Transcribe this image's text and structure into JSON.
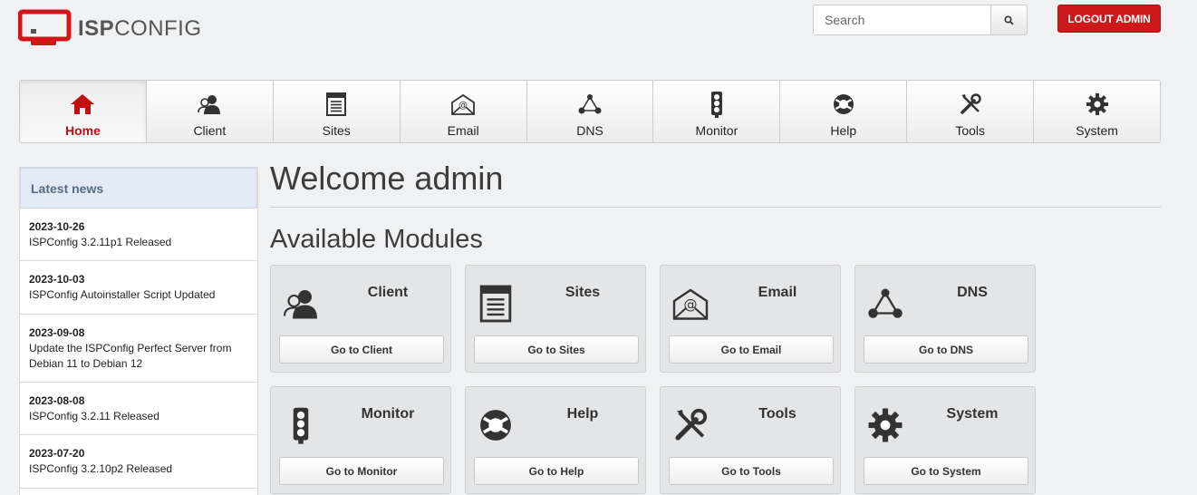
{
  "header": {
    "logo_bold": "ISP",
    "logo_light": "CONFIG",
    "search_placeholder": "Search",
    "logout_label": "LOGOUT ADMIN"
  },
  "colors": {
    "accent_red": "#cc1a1a",
    "active_nav_text": "#c20e0e",
    "sidebar_header_bg": "#e1eaf5"
  },
  "nav": [
    {
      "label": "Home",
      "icon": "home-icon",
      "active": true
    },
    {
      "label": "Client",
      "icon": "client-icon"
    },
    {
      "label": "Sites",
      "icon": "sites-icon"
    },
    {
      "label": "Email",
      "icon": "email-icon"
    },
    {
      "label": "DNS",
      "icon": "dns-icon"
    },
    {
      "label": "Monitor",
      "icon": "monitor-icon"
    },
    {
      "label": "Help",
      "icon": "help-icon"
    },
    {
      "label": "Tools",
      "icon": "tools-icon"
    },
    {
      "label": "System",
      "icon": "system-icon"
    }
  ],
  "sidebar": {
    "title": "Latest news",
    "news": [
      {
        "date": "2023-10-26",
        "title": "ISPConfig 3.2.11p1 Released"
      },
      {
        "date": "2023-10-03",
        "title": "ISPConfig Autoinstaller Script Updated"
      },
      {
        "date": "2023-09-08",
        "title": "Update the ISPConfig Perfect Server from Debian 11 to Debian 12"
      },
      {
        "date": "2023-08-08",
        "title": "ISPConfig 3.2.11 Released"
      },
      {
        "date": "2023-07-20",
        "title": "ISPConfig 3.2.10p2 Released"
      }
    ]
  },
  "main": {
    "welcome": "Welcome admin",
    "modules_heading": "Available Modules",
    "modules": [
      {
        "title": "Client",
        "button": "Go to Client",
        "icon": "client-icon"
      },
      {
        "title": "Sites",
        "button": "Go to Sites",
        "icon": "sites-icon"
      },
      {
        "title": "Email",
        "button": "Go to Email",
        "icon": "email-icon"
      },
      {
        "title": "DNS",
        "button": "Go to DNS",
        "icon": "dns-icon"
      },
      {
        "title": "Monitor",
        "button": "Go to Monitor",
        "icon": "monitor-icon"
      },
      {
        "title": "Help",
        "button": "Go to Help",
        "icon": "help-icon"
      },
      {
        "title": "Tools",
        "button": "Go to Tools",
        "icon": "tools-icon"
      },
      {
        "title": "System",
        "button": "Go to System",
        "icon": "system-icon"
      }
    ]
  }
}
